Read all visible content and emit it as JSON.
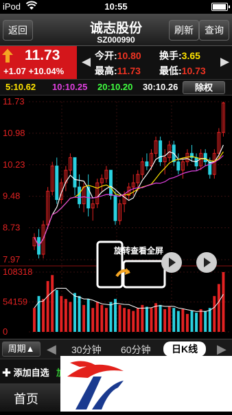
{
  "status": {
    "carrier": "iPod",
    "time": "10:55",
    "battery_level": 0.95
  },
  "nav": {
    "back": "返回",
    "title": "诚志股份",
    "code": "SZ000990",
    "refresh": "刷新",
    "query": "查询"
  },
  "quote": {
    "price": "11.73",
    "change": "+1.07",
    "change_pct": "+10.04%",
    "open_label": "今开:",
    "open": "10.80",
    "turnover_label": "换手:",
    "turnover": "3.65",
    "high_label": "最高:",
    "high": "11.73",
    "low_label": "最低:",
    "low": "10.73"
  },
  "ma": {
    "ma5": "5:10.62",
    "ma10": "10:10.25",
    "ma20": "20:10.20",
    "ma30": "30:10.26",
    "derights": "除权"
  },
  "colors": {
    "up": "#e32222",
    "down": "#2ad1e0",
    "ma5": "#ffffff",
    "ma10": "#ffe400",
    "ma20": "#e040e0",
    "ma30": "#40ff40",
    "price_box": "#d4161b"
  },
  "chart_data": {
    "type": "candlestick",
    "y_ticks": [
      "11.73",
      "10.98",
      "10.23",
      "9.48",
      "8.73",
      "7.97"
    ],
    "ylim": [
      7.97,
      11.73
    ],
    "volume_ticks": [
      "108318",
      "54159",
      "0"
    ],
    "volume_ylim": [
      0,
      108318
    ],
    "candles": [
      [
        8.3,
        8.6,
        8.2,
        8.5
      ],
      [
        8.5,
        8.7,
        8.0,
        8.1
      ],
      [
        8.1,
        8.9,
        8.0,
        8.8
      ],
      [
        8.8,
        9.7,
        8.7,
        9.6
      ],
      [
        9.6,
        10.3,
        9.5,
        10.2
      ],
      [
        10.2,
        10.4,
        9.3,
        9.4
      ],
      [
        9.4,
        9.9,
        9.3,
        9.8
      ],
      [
        9.8,
        10.2,
        9.6,
        10.1
      ],
      [
        10.1,
        10.5,
        10.0,
        10.4
      ],
      [
        10.4,
        10.4,
        9.5,
        9.7
      ],
      [
        9.7,
        10.0,
        9.2,
        9.3
      ],
      [
        9.3,
        9.8,
        9.1,
        9.7
      ],
      [
        9.7,
        10.0,
        9.0,
        9.2
      ],
      [
        9.2,
        9.4,
        8.9,
        9.3
      ],
      [
        9.3,
        9.9,
        9.2,
        9.8
      ],
      [
        9.8,
        10.0,
        9.6,
        9.9
      ],
      [
        9.9,
        10.2,
        9.8,
        10.1
      ],
      [
        10.1,
        10.1,
        9.4,
        9.5
      ],
      [
        9.5,
        9.6,
        8.8,
        8.9
      ],
      [
        8.9,
        9.4,
        8.8,
        9.3
      ],
      [
        9.3,
        9.6,
        9.1,
        9.5
      ],
      [
        9.5,
        9.8,
        9.4,
        9.7
      ],
      [
        9.7,
        10.0,
        9.5,
        9.8
      ],
      [
        9.8,
        10.1,
        9.6,
        10.0
      ],
      [
        10.0,
        10.4,
        9.9,
        10.3
      ],
      [
        10.3,
        10.5,
        10.1,
        10.2
      ],
      [
        10.2,
        10.6,
        10.1,
        10.5
      ],
      [
        10.5,
        10.9,
        10.4,
        10.8
      ],
      [
        10.8,
        10.9,
        10.2,
        10.3
      ],
      [
        10.3,
        10.6,
        10.0,
        10.4
      ],
      [
        10.4,
        10.8,
        10.3,
        10.7
      ],
      [
        10.7,
        10.8,
        10.2,
        10.3
      ],
      [
        10.3,
        10.5,
        10.0,
        10.1
      ],
      [
        10.1,
        10.4,
        9.9,
        10.3
      ],
      [
        10.3,
        10.6,
        10.2,
        10.5
      ],
      [
        10.5,
        10.7,
        10.3,
        10.4
      ],
      [
        10.4,
        10.5,
        10.1,
        10.2
      ],
      [
        10.2,
        10.6,
        10.1,
        10.5
      ],
      [
        10.5,
        10.6,
        10.2,
        10.3
      ],
      [
        10.3,
        10.4,
        9.9,
        10.0
      ],
      [
        10.0,
        10.6,
        9.9,
        10.5
      ],
      [
        10.5,
        11.1,
        10.4,
        11.0
      ],
      [
        11.0,
        11.73,
        10.9,
        11.7
      ]
    ],
    "volume": [
      40,
      60,
      55,
      85,
      95,
      70,
      60,
      55,
      50,
      65,
      60,
      45,
      55,
      40,
      50,
      45,
      40,
      50,
      55,
      45,
      40,
      38,
      35,
      40,
      45,
      42,
      40,
      48,
      45,
      38,
      42,
      40,
      35,
      38,
      30,
      35,
      32,
      38,
      35,
      40,
      60,
      80,
      100
    ]
  },
  "overlay": {
    "rotate_text": "旋转查看全屏"
  },
  "period": {
    "label": "周期▲",
    "tabs": [
      "30分钟",
      "60分钟",
      "日K线"
    ],
    "active": 2
  },
  "actions": {
    "add": "添加自选",
    "green_text": "加"
  },
  "tabbar": {
    "home": "首页"
  }
}
